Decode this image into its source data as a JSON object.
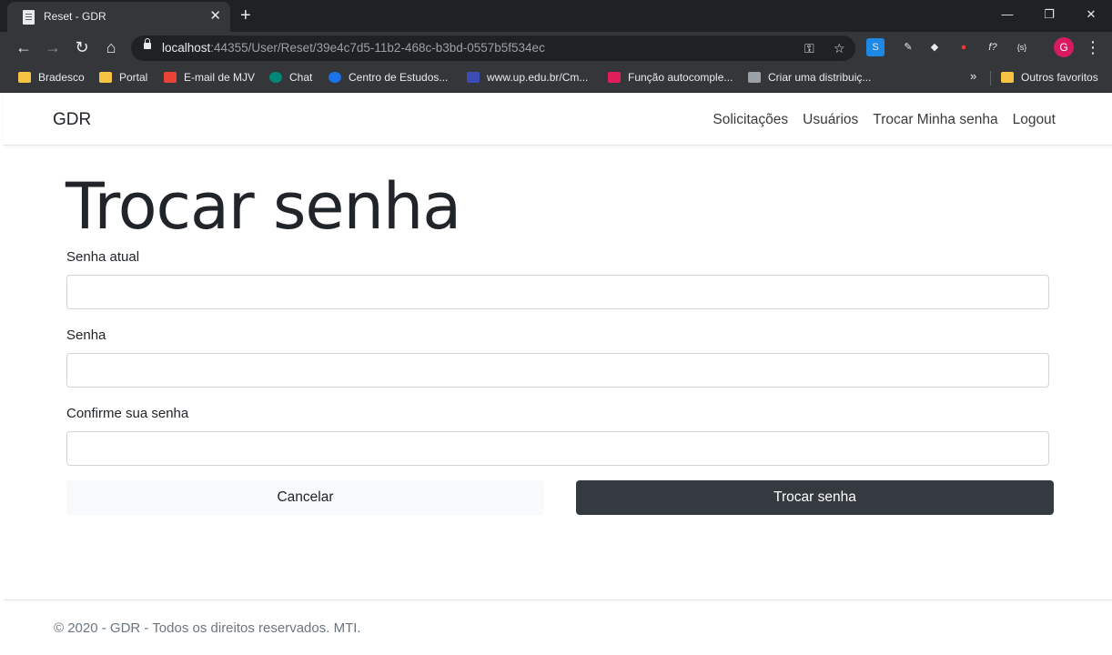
{
  "browser": {
    "tab_title": "Reset - GDR",
    "tab_close": "✕",
    "new_tab": "+",
    "window_controls": {
      "minimize": "—",
      "restore": "❐",
      "close": "✕"
    },
    "url_host": "localhost",
    "url_rest": ":44355/User/Reset/39e4c7d5-11b2-468c-b3bd-0557b5f534ec",
    "profile_initial": "G",
    "bookmarks": [
      {
        "label": "Bradesco",
        "icon": "folder-icon",
        "color": "#f6c342"
      },
      {
        "label": "Portal",
        "icon": "folder-icon",
        "color": "#f6c342"
      },
      {
        "label": "E-mail de MJV",
        "icon": "gmail-icon",
        "color": "#ea4335"
      },
      {
        "label": "Chat",
        "icon": "chat-icon",
        "color": "#00897b"
      },
      {
        "label": "Centro de Estudos...",
        "icon": "site-icon",
        "color": "#1a73e8"
      },
      {
        "label": "www.up.edu.br/Cm...",
        "icon": "star-site-icon",
        "color": "#3c4cb5"
      },
      {
        "label": "Função autocomple...",
        "icon": "slack-icon",
        "color": "#e01e5a"
      },
      {
        "label": "Criar uma distribuiç...",
        "icon": "site-icon",
        "color": "#e8eaed"
      }
    ],
    "bookmarks_more": "»",
    "other_bookmarks": "Outros favoritos"
  },
  "navbar": {
    "brand": "GDR",
    "links": [
      "Solicitações",
      "Usuários",
      "Trocar Minha senha",
      "Logout"
    ]
  },
  "form": {
    "title": "Trocar senha",
    "current_password_label": "Senha atual",
    "password_label": "Senha",
    "confirm_label": "Confirme sua senha",
    "cancel_label": "Cancelar",
    "submit_label": "Trocar senha"
  },
  "footer": {
    "text": "© 2020 - GDR - Todos os direitos reservados. MTI."
  }
}
